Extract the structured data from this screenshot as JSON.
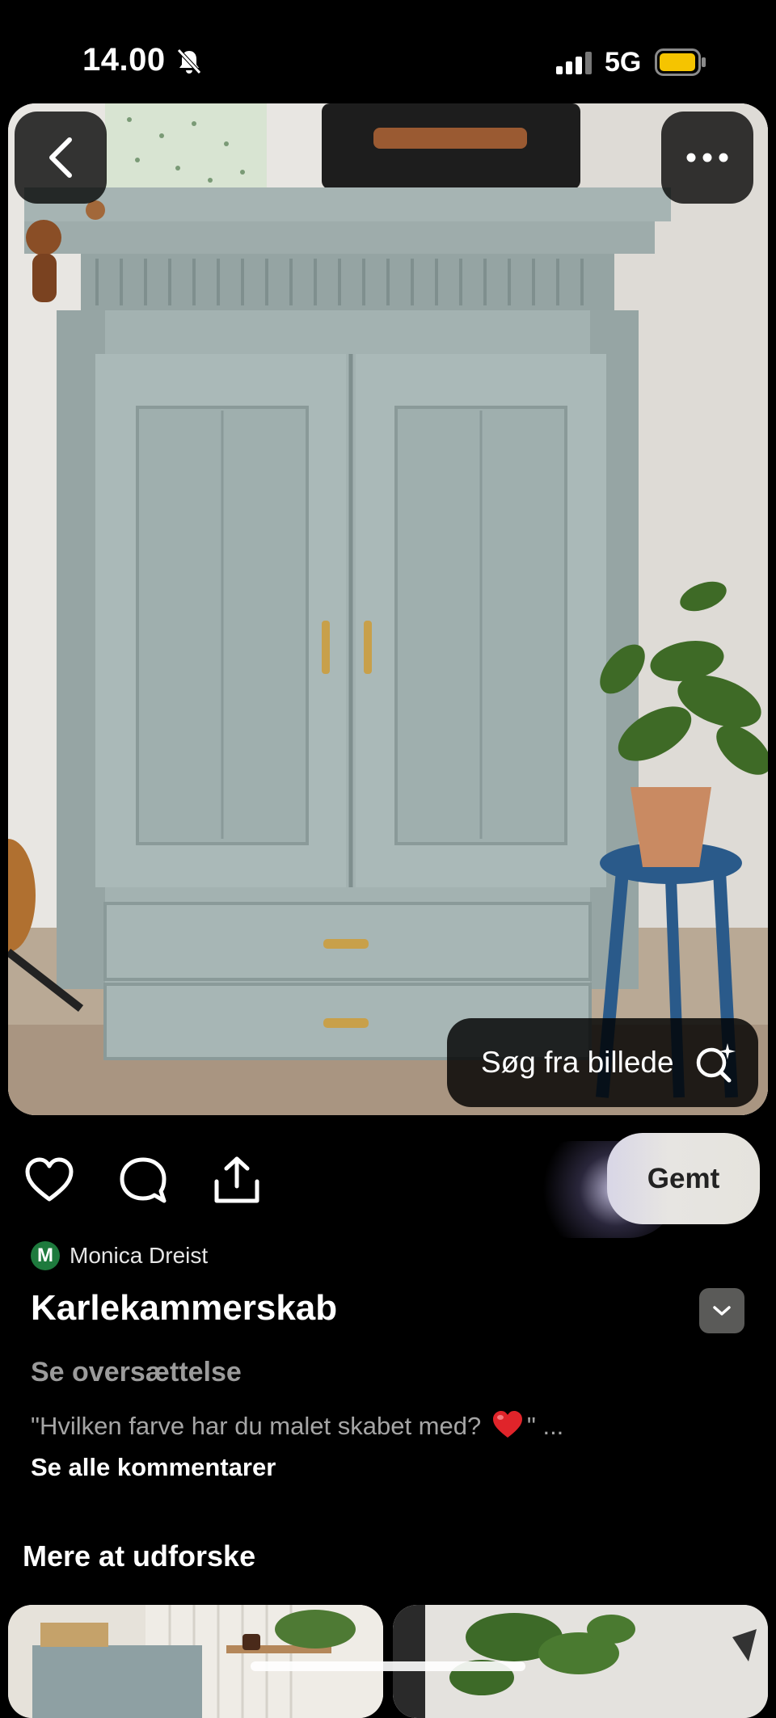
{
  "status_bar": {
    "time": "14.00",
    "network": "5G",
    "icons": [
      "bell-slash-icon",
      "signal-icon",
      "battery-icon"
    ],
    "battery_color": "#f5c400"
  },
  "pin": {
    "search_from_image": "Søg fra billede",
    "save_label": "Gemt",
    "author_initial": "M",
    "author_name": "Monica Dreist",
    "title": "Karlekammerskab",
    "translate": "Se oversættelse",
    "comment_before": "\"Hvilken farve har du malet skabet med?",
    "comment_after": "\" ...",
    "all_comments": "Se alle kommentarer",
    "accent_avatar": "#1e7a3d"
  },
  "explore": {
    "title": "Mere at udforske"
  }
}
